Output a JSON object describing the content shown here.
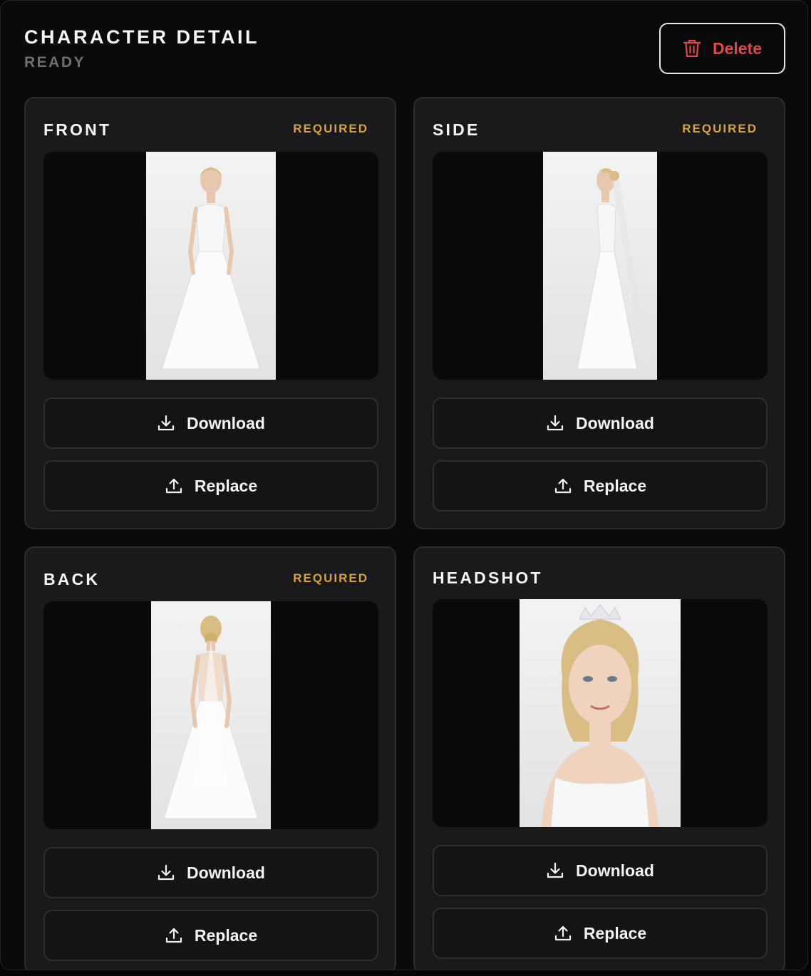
{
  "header": {
    "title": "CHARACTER DETAIL",
    "status": "READY",
    "delete_label": "Delete"
  },
  "colors": {
    "accent_red": "#e0474b",
    "required_gold": "#d7a33c",
    "card_bg": "#1a1a1c"
  },
  "cards": [
    {
      "label": "FRONT",
      "badge": "REQUIRED",
      "download_label": "Download",
      "replace_label": "Replace",
      "image": "bride-front-full-body"
    },
    {
      "label": "SIDE",
      "badge": "REQUIRED",
      "download_label": "Download",
      "replace_label": "Replace",
      "image": "bride-side-full-body"
    },
    {
      "label": "BACK",
      "badge": "REQUIRED",
      "download_label": "Download",
      "replace_label": "Replace",
      "image": "bride-back-full-body"
    },
    {
      "label": "HEADSHOT",
      "badge": "",
      "download_label": "Download",
      "replace_label": "Replace",
      "image": "bride-headshot"
    }
  ]
}
